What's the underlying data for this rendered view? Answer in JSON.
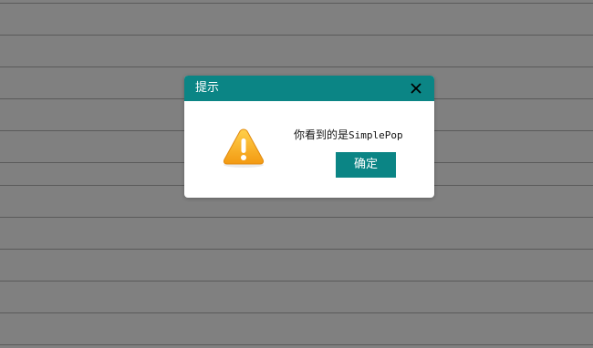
{
  "page": {
    "background_color": "#808080",
    "line_color": "#5a5a5a"
  },
  "dialog": {
    "title": "提示",
    "close_icon": "close-icon",
    "warning_icon": "warning-icon",
    "message_prefix": "你看到的是",
    "message_suffix": "SimplePop",
    "ok_label": "确定",
    "accent_color": "#0b8585"
  }
}
